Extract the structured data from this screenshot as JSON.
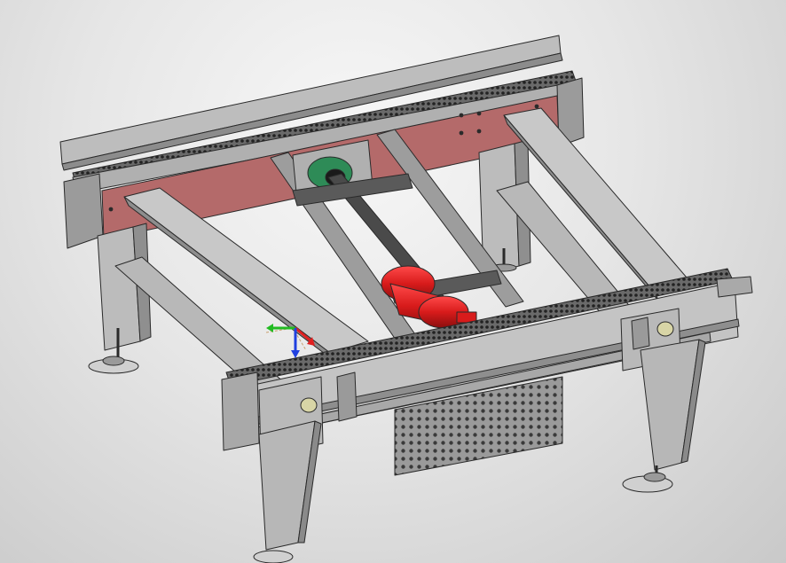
{
  "viewport": {
    "background_colors": [
      "#f7f7f7",
      "#c9c9c9"
    ],
    "colors": {
      "frame_light": "#c8c8c8",
      "frame_mid": "#a9a9a9",
      "frame_dark": "#7a7a7a",
      "panel_red": "#b46a6a",
      "motor_red": "#d81b1b",
      "bearing_green": "#2e8b57",
      "axis_x": "#e02020",
      "axis_y": "#22bb22",
      "axis_z": "#2040e0",
      "edge": "#2a2a2a"
    },
    "icons": [
      "triad-axes-icon"
    ]
  }
}
